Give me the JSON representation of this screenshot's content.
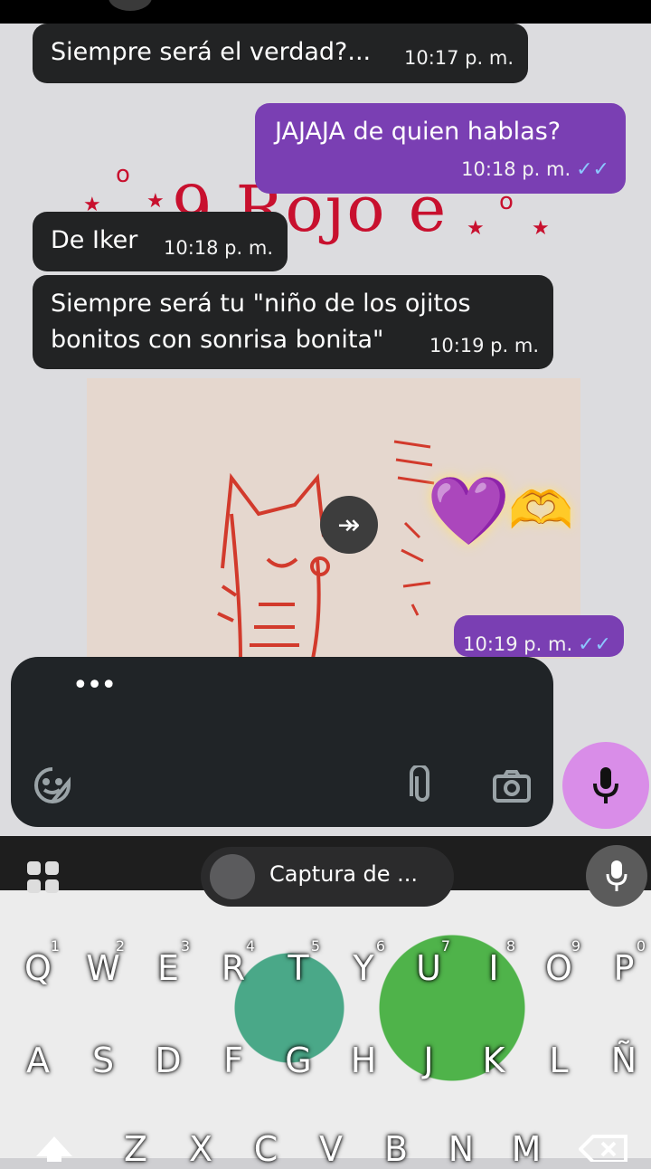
{
  "chat": {
    "wallpaper_title": "9 Rojo e",
    "messages": [
      {
        "text": "Siempre será el verdad?...",
        "time": "10:17 p. m."
      },
      {
        "text": "JAJAJA de quien hablas?",
        "time": "10:18 p. m.",
        "status": "✓✓"
      },
      {
        "text": "De Iker",
        "time": "10:18 p. m."
      },
      {
        "line1": "Siempre será tu \"niño de los ojitos",
        "line2": "bonitos con sonrisa bonita\"",
        "time": "10:19 p. m."
      },
      {
        "time": "10:19 p. m.",
        "status": "✓✓"
      }
    ],
    "reaction_heart": "💜",
    "reaction_hands": "🫶"
  },
  "composer": {
    "typing_indicator": "•••",
    "icons": [
      "sticker-icon",
      "attach-icon",
      "camera-icon",
      "mic-icon"
    ]
  },
  "keyboard": {
    "suggestion": "Captura de ...",
    "row1": [
      {
        "k": "Q",
        "n": "1"
      },
      {
        "k": "W",
        "n": "2"
      },
      {
        "k": "E",
        "n": "3"
      },
      {
        "k": "R",
        "n": "4"
      },
      {
        "k": "T",
        "n": "5"
      },
      {
        "k": "Y",
        "n": "6"
      },
      {
        "k": "U",
        "n": "7"
      },
      {
        "k": "I",
        "n": "8"
      },
      {
        "k": "O",
        "n": "9"
      },
      {
        "k": "P",
        "n": "0"
      }
    ],
    "row2": [
      "A",
      "S",
      "D",
      "F",
      "G",
      "H",
      "J",
      "K",
      "L",
      "Ñ"
    ],
    "row3": [
      "Z",
      "X",
      "C",
      "V",
      "B",
      "N",
      "M"
    ],
    "colors": {
      "accent": "#7a3fb3",
      "mic": "#d98de8"
    }
  }
}
